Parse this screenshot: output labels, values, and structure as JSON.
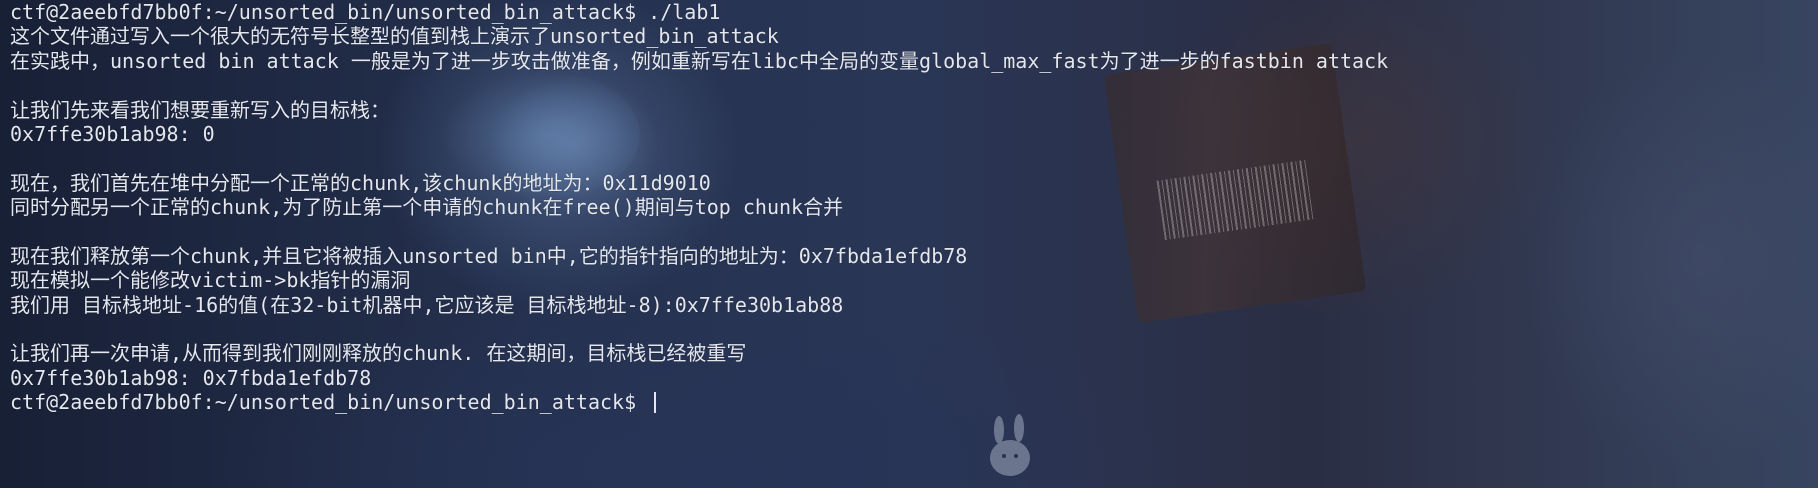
{
  "terminal": {
    "lines": [
      "ctf@2aeebfd7bb0f:~/unsorted_bin/unsorted_bin_attack$ ./lab1",
      "这个文件通过写入一个很大的无符号长整型的值到栈上演示了unsorted_bin_attack",
      "在实践中，unsorted bin attack 一般是为了进一步攻击做准备，例如重新写在libc中全局的变量global_max_fast为了进一步的fastbin attack",
      "",
      "让我们先来看我们想要重新写入的目标栈：",
      "0x7ffe30b1ab98: 0",
      "",
      "现在，我们首先在堆中分配一个正常的chunk,该chunk的地址为：0x11d9010",
      "同时分配另一个正常的chunk,为了防止第一个申请的chunk在free()期间与top chunk合并",
      "",
      "现在我们释放第一个chunk,并且它将被插入unsorted bin中,它的指针指向的地址为：0x7fbda1efdb78",
      "现在模拟一个能修改victim->bk指针的漏洞",
      "我们用 目标栈地址-16的值(在32-bit机器中,它应该是 目标栈地址-8):0x7ffe30b1ab88",
      "",
      "让我们再一次申请,从而得到我们刚刚释放的chunk. 在这期间，目标栈已经被重写",
      "0x7ffe30b1ab98: 0x7fbda1efdb78"
    ],
    "prompt": "ctf@2aeebfd7bb0f:~/unsorted_bin/unsorted_bin_attack$ "
  },
  "colors": {
    "text": "#e4e7ee",
    "background": "#1a2238"
  }
}
